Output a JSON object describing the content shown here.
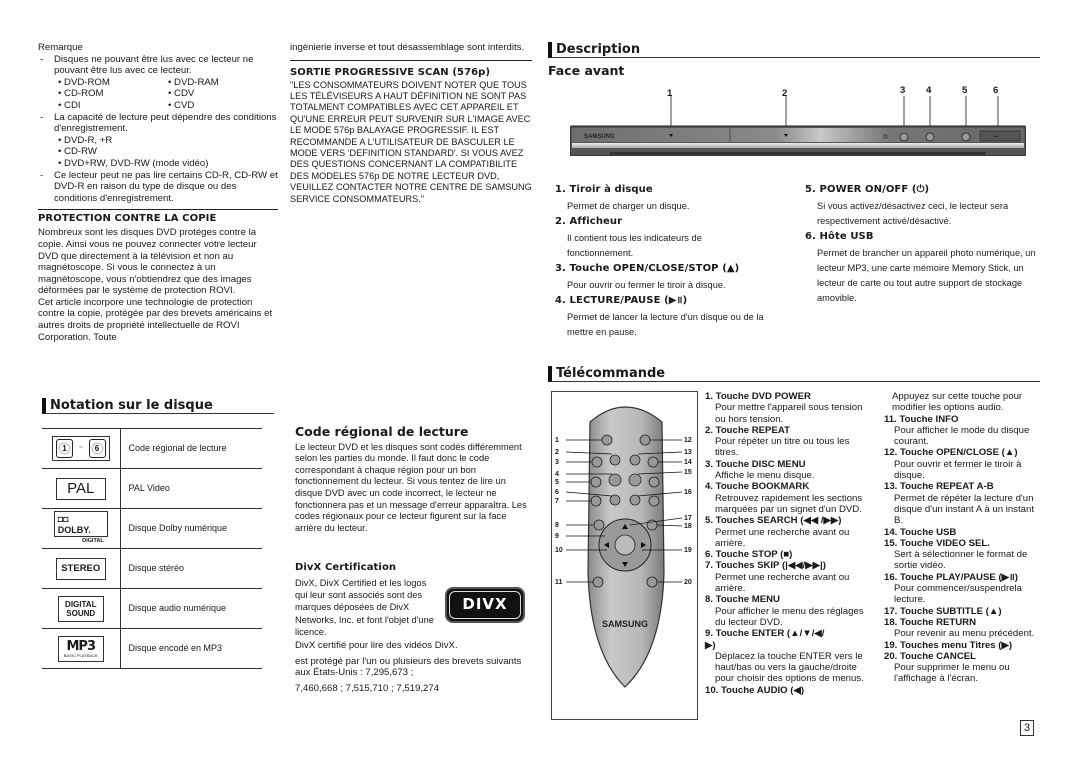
{
  "col1": {
    "remarque_title": "Remarque",
    "dash1": "Disques ne pouvant être lus avec ce lecteur ne pouvant être lus avec ce lecteur.",
    "unsupported": [
      [
        "• DVD-ROM",
        "• DVD-RAM"
      ],
      [
        "• CD-ROM",
        "• CDV"
      ],
      [
        "• CDI",
        "• CVD"
      ]
    ],
    "dash2": "La capacité de lecture peut dépendre des conditions d'enregistrement.",
    "supported": [
      "• DVD-R, +R",
      "• CD-RW",
      "• DVD+RW, DVD-RW (mode vidéo)"
    ],
    "dash3": "Ce lecteur peut ne pas lire certains CD-R, CD-RW et DVD-R en raison du type de disque ou des conditions d'enregistrement.",
    "protection_title": "PROTECTION CONTRE LA COPIE",
    "protection_p1": "Nombreux sont les disques DVD protéges contre la copie. Ainsi vous ne pouvez connecter votre lecteur DVD que directement à la télévision et non au magnétoscope. Si vous le connectez à un magnétoscope, vous n'obtiendrez que des images déformées par le système de protection ROVI.",
    "protection_p2": "Cet article incorpore une technologie de protection contre la copie, protégée par des brevets américains et autres droits de propriété intellectuelle de ROVI Corporation. Toute"
  },
  "col2": {
    "cont": "ingénierie inverse et tout désassemblage sont interdits.",
    "progressive_title": "SORTIE PROGRESSIVE SCAN (576p)",
    "progressive_body": "\"LES CONSOMMATEURS DOIVENT NOTER QUE TOUS LES TÉLÉVISEURS A HAUT DÉFINITION NE SONT PAS TOTALMENT COMPATIBLES AVEC CET APPAREIL ET QU'UNE ERREUR PEUT SURVENIR SUR L'IMAGE AVEC LE MODE 576p BALAYAGE PROGRESSIF. IL EST RECOMMANDE A L'UTILISATEUR DE BASCULER LE MODE VERS 'DEFINITION STANDARD'. SI VOUS AVEZ DES QUESTIONS CONCERNANT LA COMPATIBILITE DES MODELES 576p DE NOTRE LECTEUR DVD, VEUILLEZ CONTACTER NOTRE CENTRE DE SAMSUNG SERVICE CONSOMMATEURS.\""
  },
  "notation": {
    "title": "Notation sur le disque",
    "rows": [
      {
        "icon": "region-code-icon",
        "logo": "1 ~ 6",
        "label": "Code régional de lecture"
      },
      {
        "icon": "pal-logo",
        "logo": "PAL",
        "label": "PAL Video"
      },
      {
        "icon": "dolby-digital-logo",
        "logo": "DOLBY DIGITAL",
        "label": "Disque Dolby numérique"
      },
      {
        "icon": "stereo-logo",
        "logo": "STEREO",
        "label": "Disque stéréo"
      },
      {
        "icon": "digital-sound-logo",
        "logo": "DIGITAL SOUND",
        "label": "Disque audio numérique"
      },
      {
        "icon": "mp3-logo",
        "logo": "MP3",
        "label": "Disque encodé en MP3"
      }
    ]
  },
  "region": {
    "title": "Code régional de lecture",
    "body": "Le lecteur DVD et les disques sont codés différemment selon les parties du monde. Il faut donc le code correspondant à chaque région pour un bon fonctionnement du lecteur. Si vous tentez de lire un disque DVD avec un code incorrect, le lecteur ne fonctionnera pas et un message d'erreur apparaîtra. Les codes régionaux pour ce lecteur figurent sur la face arrière du lecteur."
  },
  "divx": {
    "title": "DivX Certification",
    "body": "DivX, DivX Certified et les logos qui leur sont associés sont des marques déposées de DivX Networks, Inc. et font l'objet d'une licence.",
    "certified": "DivX certifié pour lire des vidéos DivX.",
    "patents1": "est protégé par l'un ou plusieurs des brevets suivants aux États-Unis : 7,295,673 ;",
    "patents2": "7,460,668 ; 7,515,710 ; 7,519,274",
    "logo": "DIVX"
  },
  "description": {
    "title": "Description",
    "face_title": "Face avant",
    "callouts": [
      "1",
      "2",
      "3",
      "4",
      "5",
      "6"
    ],
    "brand": "SAMSUNG",
    "items_left": [
      {
        "title": "1. Tiroir à disque",
        "text": "Permet de charger un disque."
      },
      {
        "title": "2. Afficheur",
        "text": "Il contient tous les indicateurs de fonctionnement."
      },
      {
        "title": "3. Touche OPEN/CLOSE/STOP (▲)",
        "text": "Pour ouvrir ou fermer le tiroir à disque."
      },
      {
        "title": "4. LECTURE/PAUSE (▶॥)",
        "text": "Permet de lancer la lecture d'un disque ou de la mettre en pause."
      }
    ],
    "items_right": [
      {
        "title": "5. POWER ON/OFF (⏻)",
        "text": "Si vous activez/désactivez ceci, le lecteur sera respectivement activé/désactivé."
      },
      {
        "title": "6. Hôte USB",
        "text": "Permet de brancher un appareil photo numérique, un lecteur MP3, une carte mémoire Memory Stick, un lecteur de carte ou tout autre support de stockage amovible."
      }
    ]
  },
  "remote": {
    "title": "Télécommande",
    "brand": "SAMSUNG",
    "callouts_left": [
      "1",
      "2",
      "3",
      "4",
      "5",
      "6",
      "7",
      "8",
      "9",
      "10",
      "11"
    ],
    "callouts_right": [
      "12",
      "13",
      "14",
      "15",
      "16",
      "17",
      "18",
      "19",
      "20"
    ],
    "list_a": [
      {
        "title": "1.  Touche DVD POWER",
        "text": "Pour mettre l'appareil sous tension ou hors tension."
      },
      {
        "title": "2.  Touche REPEAT",
        "text": "Pour répéter un titre ou tous les titres."
      },
      {
        "title": "3.  Touche DISC MENU",
        "text": "Affiche le menu disque."
      },
      {
        "title": "4.  Touche BOOKMARK",
        "text": "Retrouvez rapidement les sections marquées par un signet d'un DVD."
      },
      {
        "title": "5.  Touches SEARCH (◀◀ /▶▶)",
        "text": "Permet une recherche avant ou arrière."
      },
      {
        "title": "6.  Touche STOP (■)",
        "text": ""
      },
      {
        "title": "7.  Touches SKIP (|◀◀/▶▶|)",
        "text": "Permet une recherche avant ou arrière."
      },
      {
        "title": "8.  Touche MENU",
        "text": "Pour afficher le menu des réglages du lecteur DVD."
      },
      {
        "title": "9.  Touche ENTER (▲/▼/◀/▶)",
        "text": "Déplacez la touche ENTER vers le haut/bas ou vers la gauche/droite pour choisir des options de menus."
      },
      {
        "title": "10. Touche  AUDIO (◀)",
        "text": ""
      }
    ],
    "list_b_intro": "Appuyez sur cette touche pour modifier les options audio.",
    "list_b": [
      {
        "title": "11. Touche INFO",
        "text": "Pour afficher le mode du disque courant."
      },
      {
        "title": "12. Touche OPEN/CLOSE  (▲)",
        "text": "Pour ouvrir et fermer le tiroir à disque."
      },
      {
        "title": "13. Touche REPEAT A-B",
        "text": "Permet de répéter la lecture d'un disque d'un instant A à un instant B."
      },
      {
        "title": "14. Touche USB",
        "text": ""
      },
      {
        "title": "15. Touche VIDEO SEL.",
        "text": "Sert à sélectionner le format de sortie vidéo."
      },
      {
        "title": "16. Touche PLAY/PAUSE (▶॥)",
        "text": "Pour commencer/suspendrela lecture."
      },
      {
        "title": "17. Touche SUBTITLE (▲)",
        "text": ""
      },
      {
        "title": "18. Touche RETURN",
        "text": "Pour revenir au menu précédent."
      },
      {
        "title": "19. Touches menu Titres (▶)",
        "text": ""
      },
      {
        "title": "20.  Touche CANCEL",
        "text": "Pour supprimer le menu ou l'affichage à l'écran."
      }
    ]
  },
  "page_number": "3"
}
